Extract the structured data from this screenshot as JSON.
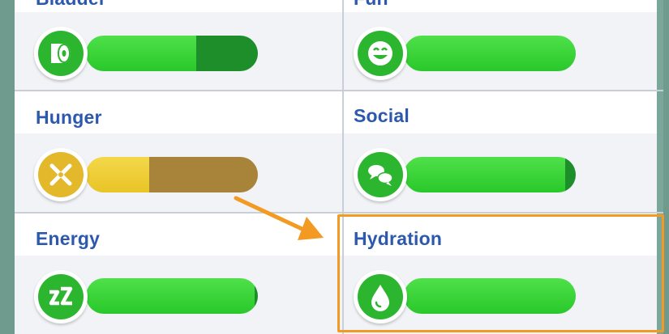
{
  "needs": [
    {
      "id": "bladder",
      "label": "Bladder",
      "level": 0.64,
      "state": "green",
      "icon": "toilet-paper-icon"
    },
    {
      "id": "fun",
      "label": "Fun",
      "level": 1.0,
      "state": "green",
      "icon": "smiley-icon"
    },
    {
      "id": "hunger",
      "label": "Hunger",
      "level": 0.37,
      "state": "yellow",
      "icon": "fork-knife-icon"
    },
    {
      "id": "social",
      "label": "Social",
      "level": 0.94,
      "state": "green",
      "icon": "speech-bubbles-icon"
    },
    {
      "id": "energy",
      "label": "Energy",
      "level": 0.98,
      "state": "green",
      "icon": "zz-icon"
    },
    {
      "id": "hydration",
      "label": "Hydration",
      "level": 1.0,
      "state": "green",
      "icon": "water-drop-icon"
    }
  ],
  "colors": {
    "green_full": "#29c82a",
    "green_dark": "#1e8e2a",
    "yellow_full": "#e8c426",
    "yellow_dark": "#a8843a",
    "label": "#2c58ad",
    "highlight": "#f39a22"
  }
}
